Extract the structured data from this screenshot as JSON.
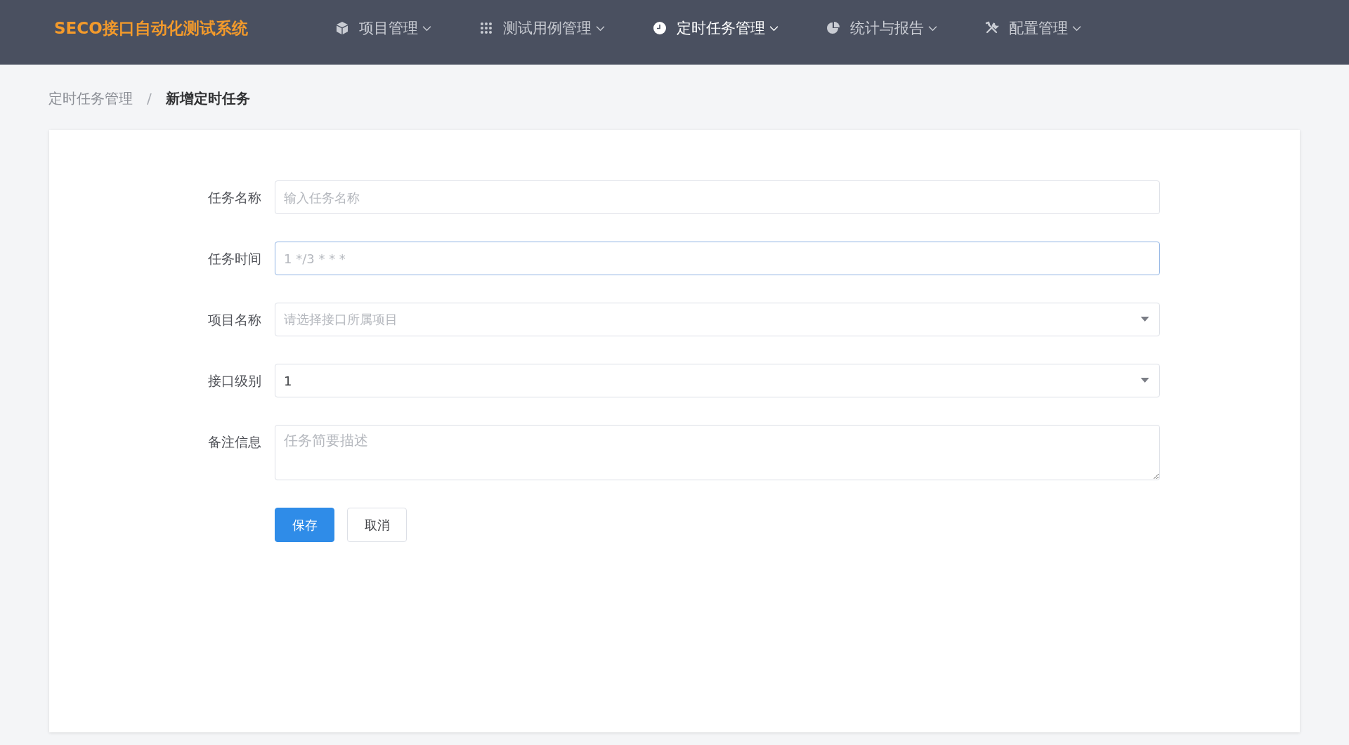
{
  "header": {
    "logo": "SECO接口自动化测试系统",
    "nav": [
      {
        "label": "项目管理",
        "selected": false
      },
      {
        "label": "测试用例管理",
        "selected": false
      },
      {
        "label": "定时任务管理",
        "selected": true
      },
      {
        "label": "统计与报告",
        "selected": false
      },
      {
        "label": "配置管理",
        "selected": false
      }
    ]
  },
  "breadcrumb_separator": "/",
  "breadcrumb": [
    {
      "label": "定时任务管理",
      "current": false
    },
    {
      "label": "新增定时任务",
      "current": true
    }
  ],
  "form": {
    "fields": [
      {
        "kind": "input",
        "label": "任务名称",
        "placeholder": "输入任务名称",
        "focused": false
      },
      {
        "kind": "input",
        "label": "任务时间",
        "placeholder": "1 */3 * * *",
        "focused": true
      },
      {
        "kind": "select",
        "label": "项目名称",
        "placeholder": "请选择接口所属项目",
        "focused": false
      },
      {
        "kind": "select",
        "label": "接口级别",
        "value": "1",
        "focused": false
      },
      {
        "kind": "textarea",
        "label": "备注信息",
        "placeholder": "任务简要描述",
        "focused": false
      }
    ],
    "buttons": [
      {
        "label": "保存",
        "kind": "primary"
      },
      {
        "label": "取消",
        "kind": "default"
      }
    ]
  }
}
